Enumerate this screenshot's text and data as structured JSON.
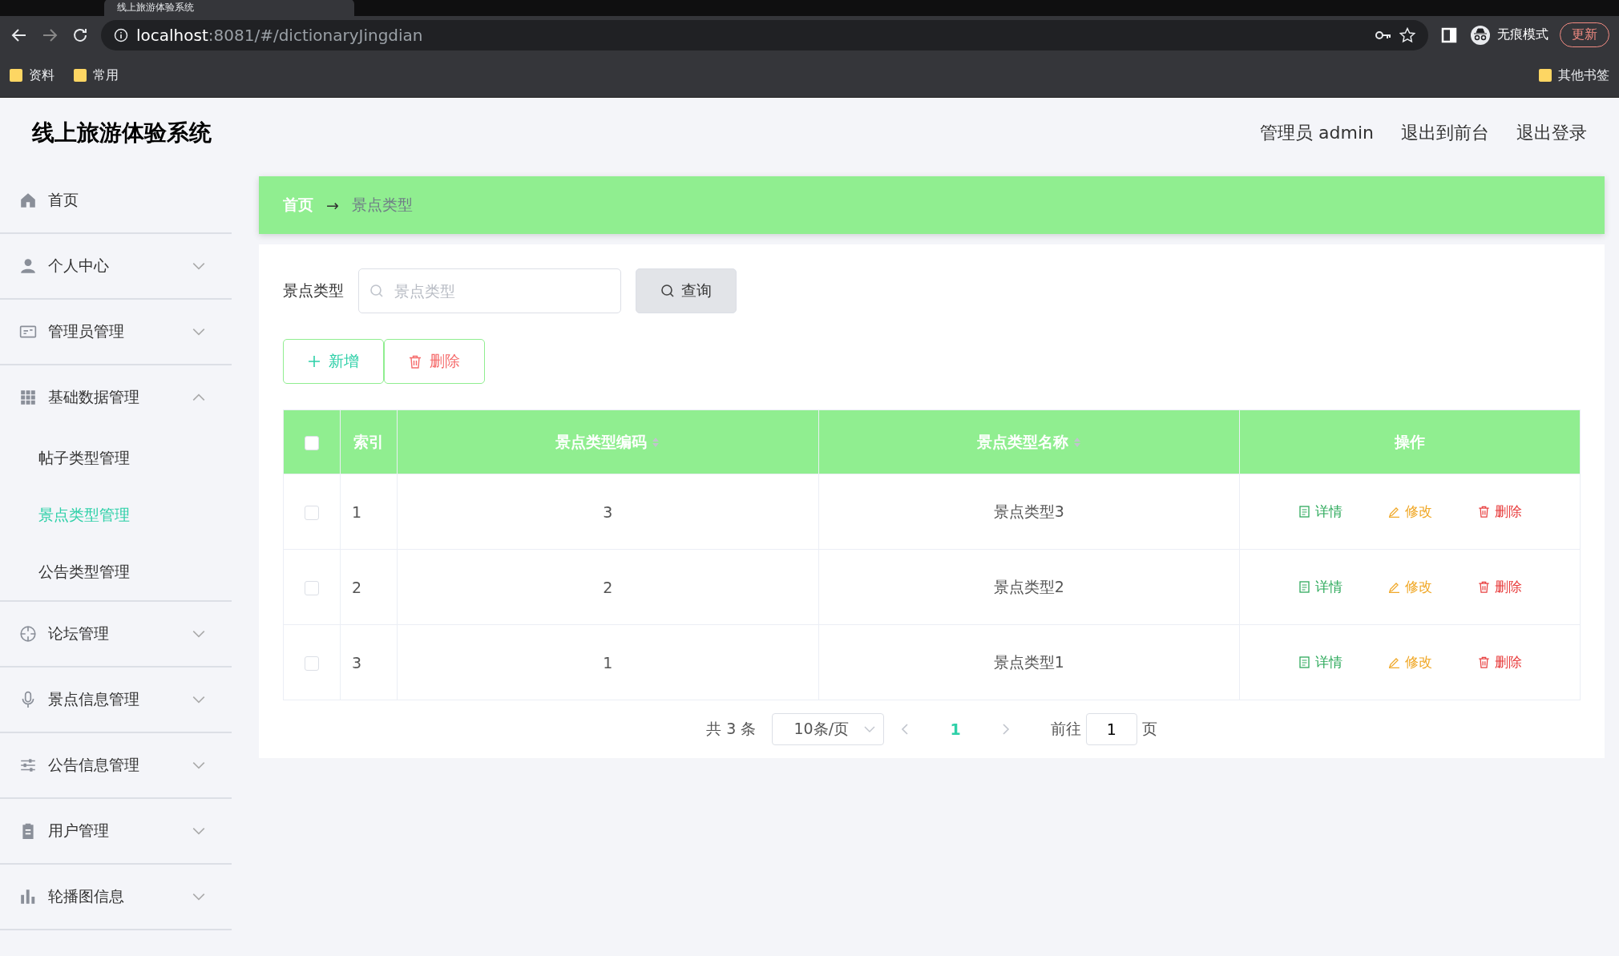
{
  "browser": {
    "tab_title": "线上旅游体验系统",
    "url_host": "localhost",
    "url_rest": ":8081/#/dictionaryJingdian",
    "incognito": "无痕模式",
    "update": "更新",
    "bookmarks": [
      "资料",
      "常用"
    ],
    "other_bookmarks": "其他书签"
  },
  "header": {
    "title": "线上旅游体验系统",
    "links": [
      "管理员 admin",
      "退出到前台",
      "退出登录"
    ]
  },
  "sidebar": {
    "items": [
      {
        "label": "首页",
        "kind": "home"
      },
      {
        "label": "个人中心",
        "kind": "user",
        "expanded": false
      },
      {
        "label": "管理员管理",
        "kind": "card",
        "expanded": false
      },
      {
        "label": "基础数据管理",
        "kind": "grid",
        "expanded": true,
        "children": [
          {
            "label": "帖子类型管理",
            "selected": false
          },
          {
            "label": "景点类型管理",
            "selected": true
          },
          {
            "label": "公告类型管理",
            "selected": false
          }
        ]
      },
      {
        "label": "论坛管理",
        "kind": "target",
        "expanded": false
      },
      {
        "label": "景点信息管理",
        "kind": "mic",
        "expanded": false
      },
      {
        "label": "公告信息管理",
        "kind": "sliders",
        "expanded": false
      },
      {
        "label": "用户管理",
        "kind": "clipboard",
        "expanded": false
      },
      {
        "label": "轮播图信息",
        "kind": "chart",
        "expanded": false
      }
    ]
  },
  "breadcrumb": {
    "home": "首页",
    "separator": "→",
    "current": "景点类型"
  },
  "search": {
    "label": "景点类型",
    "placeholder": "景点类型",
    "button": "查询"
  },
  "actions": {
    "add": "新增",
    "delete": "删除"
  },
  "table": {
    "columns": [
      {
        "label": "索引",
        "sortable": false
      },
      {
        "label": "景点类型编码",
        "sortable": true
      },
      {
        "label": "景点类型名称",
        "sortable": true
      },
      {
        "label": "操作",
        "sortable": false
      }
    ],
    "select_all_checked": false,
    "rows": [
      {
        "index": "1",
        "code": "3",
        "name": "景点类型3",
        "checked": false,
        "actions": [
          "详情",
          "修改",
          "删除"
        ]
      },
      {
        "index": "2",
        "code": "2",
        "name": "景点类型2",
        "checked": false,
        "actions": [
          "详情",
          "修改",
          "删除"
        ]
      },
      {
        "index": "3",
        "code": "1",
        "name": "景点类型1",
        "checked": false,
        "actions": [
          "详情",
          "修改",
          "删除"
        ]
      }
    ]
  },
  "pagination": {
    "total": "共 3 条",
    "page_size": "10条/页",
    "pages": [
      {
        "label": "1",
        "selected": true
      }
    ],
    "goto_label": "前往",
    "goto_value": "1",
    "goto_suffix": "页"
  }
}
